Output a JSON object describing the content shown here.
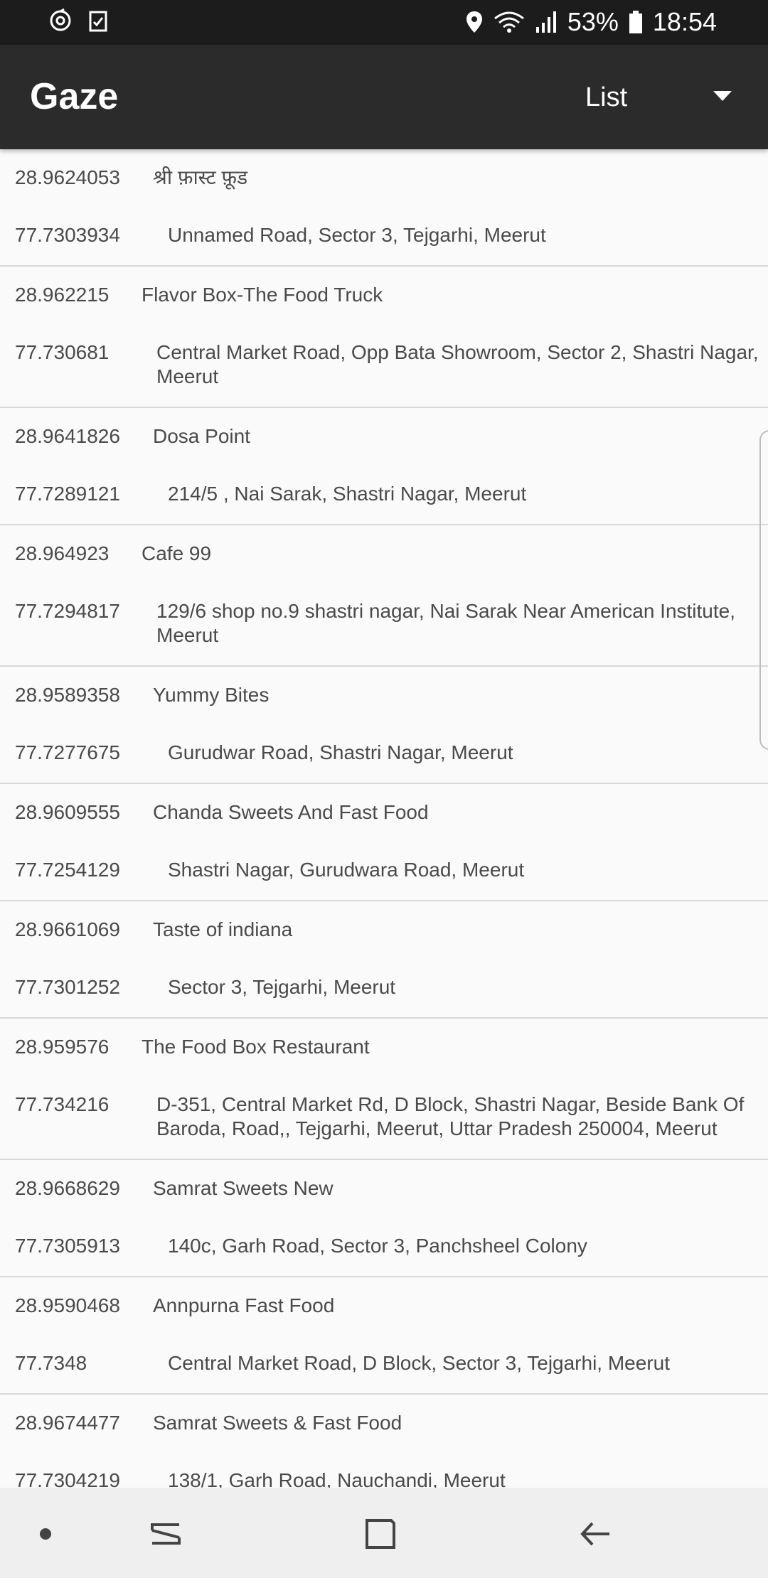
{
  "status_bar": {
    "battery": "53%",
    "time": "18:54",
    "icons": [
      "sync-icon",
      "clipboard-check-icon",
      "location-icon",
      "wifi-icon",
      "signal-icon",
      "battery-icon"
    ]
  },
  "app_bar": {
    "title": "Gaze",
    "view_selector": "List"
  },
  "list": {
    "items": [
      {
        "lat": "28.9624053",
        "lng": "77.7303934",
        "name": "श्री फ़ास्ट फ़ूड",
        "address": "Unnamed Road, Sector 3, Tejgarhi, Meerut"
      },
      {
        "lat": "28.962215",
        "lng": "77.730681",
        "name": "Flavor Box-The Food Truck",
        "address": "Central Market Road, Opp Bata Showroom, Sector 2, Shastri Nagar, Meerut"
      },
      {
        "lat": "28.9641826",
        "lng": "77.7289121",
        "name": "Dosa Point",
        "address": "214/5 , Nai Sarak, Shastri Nagar, Meerut"
      },
      {
        "lat": "28.964923",
        "lng": "77.7294817",
        "name": "Cafe 99",
        "address": "129/6 shop no.9 shastri nagar, Nai Sarak Near American Institute, Meerut"
      },
      {
        "lat": "28.9589358",
        "lng": "77.7277675",
        "name": "Yummy Bites",
        "address": "Gurudwar Road, Shastri Nagar, Meerut"
      },
      {
        "lat": "28.9609555",
        "lng": "77.7254129",
        "name": "Chanda Sweets And Fast Food",
        "address": "Shastri Nagar, Gurudwara Road, Meerut"
      },
      {
        "lat": "28.9661069",
        "lng": "77.7301252",
        "name": "Taste of indiana",
        "address": "Sector 3, Tejgarhi, Meerut"
      },
      {
        "lat": "28.959576",
        "lng": "77.734216",
        "name": "The Food Box Restaurant",
        "address": "D-351, Central Market Rd, D Block, Shastri Nagar, Beside Bank Of Baroda, Road,, Tejgarhi, Meerut, Uttar Pradesh 250004, Meerut"
      },
      {
        "lat": "28.9668629",
        "lng": "77.7305913",
        "name": "Samrat Sweets New",
        "address": "140c, Garh Road, Sector 3, Panchsheel Colony"
      },
      {
        "lat": "28.9590468",
        "lng": "77.7348",
        "name": "Annpurna Fast Food",
        "address": "Central Market Road, D Block, Sector 3, Tejgarhi, Meerut"
      },
      {
        "lat": "28.9674477",
        "lng": "77.7304219",
        "name": "Samrat Sweets & Fast Food",
        "address": "138/1, Garh Road, Nauchandi, Meerut"
      }
    ]
  },
  "nav_bar": {
    "buttons": [
      "dot-icon",
      "recents-icon",
      "home-icon",
      "back-icon"
    ]
  }
}
